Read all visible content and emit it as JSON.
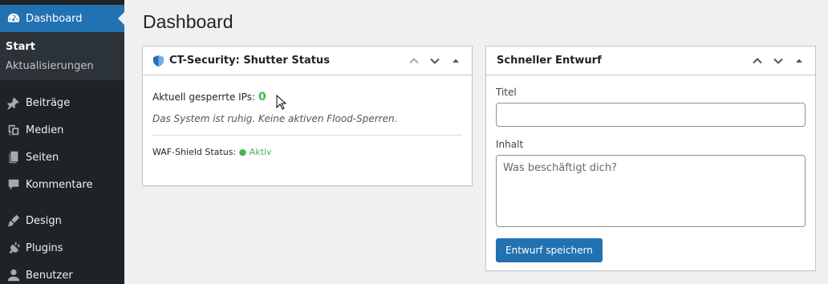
{
  "sidebar": {
    "items": [
      {
        "label": "Dashboard",
        "icon": "dashboard-icon",
        "current": true
      },
      {
        "label": "Beiträge",
        "icon": "pin-icon"
      },
      {
        "label": "Medien",
        "icon": "media-icon"
      },
      {
        "label": "Seiten",
        "icon": "page-icon"
      },
      {
        "label": "Kommentare",
        "icon": "comment-icon"
      },
      {
        "label": "Design",
        "icon": "brush-icon"
      },
      {
        "label": "Plugins",
        "icon": "plugin-icon"
      },
      {
        "label": "Benutzer",
        "icon": "user-icon"
      }
    ],
    "submenu": [
      {
        "label": "Start",
        "active": true
      },
      {
        "label": "Aktualisierungen"
      }
    ]
  },
  "page": {
    "title": "Dashboard"
  },
  "security_widget": {
    "title": "CT-Security: Shutter Status",
    "blocked_label": "Aktuell gesperrte IPs:",
    "blocked_count": "0",
    "quiet_message": "Das System ist ruhig. Keine aktiven Flood-Sperren.",
    "waf_label": "WAF-Shield Status:",
    "waf_state": "● Aktiv"
  },
  "draft_widget": {
    "title": "Schneller Entwurf",
    "title_label": "Titel",
    "title_value": "",
    "content_label": "Inhalt",
    "content_placeholder": "Was beschäftigt dich?",
    "save_label": "Entwurf speichern"
  },
  "colors": {
    "sidebar_bg": "#1d2327",
    "accent": "#2271b1",
    "success": "#46b450",
    "page_bg": "#f0f0f1"
  }
}
